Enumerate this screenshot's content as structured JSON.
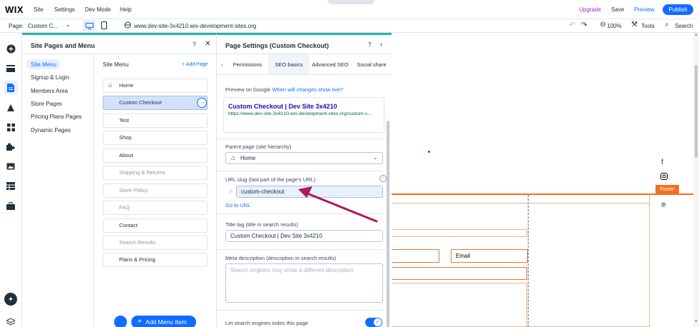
{
  "topbar": {
    "logo": "WIX",
    "menu": [
      "Site",
      "Settings",
      "Dev Mode",
      "Help"
    ],
    "upgrade": "Upgrade",
    "save": "Save",
    "preview": "Preview",
    "publish": "Publish"
  },
  "bar2": {
    "page_label": "Page:",
    "page_value": "Custom C...",
    "url": "www.dev-site-3x4210.wix-development-sites.org",
    "zoom": "100%",
    "tools": "Tools",
    "search": "Search"
  },
  "pages_panel": {
    "title": "Site Pages and Menu",
    "help": "?",
    "categories": [
      "Site Menu",
      "Signup & Login",
      "Members Area",
      "Store Pages",
      "Pricing Plans Pages",
      "Dynamic Pages"
    ],
    "menu_header": "Site Menu",
    "add_page": "+ Add Page",
    "pages": [
      "Home",
      "Custom Checkout",
      "Test",
      "Shop",
      "About",
      "Shipping & Returns",
      "Store Policy",
      "FAQ",
      "Contact",
      "Search Results",
      "Plans & Pricing"
    ],
    "add_menu_item": "Add Menu Item"
  },
  "settings_panel": {
    "title": "Page Settings (Custom Checkout)",
    "help": "?",
    "tabs": [
      "Permissions",
      "SEO basics",
      "Advanced SEO",
      "Social share"
    ],
    "preview_label": "Preview on Google",
    "preview_link": "When will changes show live?",
    "google_title": "Custom Checkout | Dev Site 3x4210",
    "google_url": "https://www.dev-site-3x4210.wix-development-sites.org/custom-c...",
    "parent_label": "Parent page (site hierarchy)",
    "parent_value": "Home",
    "slug_label": "URL slug (last part of the page's URL)",
    "slug_prefix": "/",
    "slug_value": "custom-checkout",
    "go_to_url": "Go to URL",
    "title_tag_label": "Title tag (title in search results)",
    "title_tag_value": "Custom Checkout | Dev Site 3x4210",
    "meta_label": "Meta description (description in search results)",
    "meta_placeholder": "Search engines may show a different description",
    "index_label": "Let search engines index this page",
    "index_on": true
  },
  "canvas": {
    "footer_badge": "Footer",
    "email_field": "Email"
  },
  "colors": {
    "accent_blue": "#116dff",
    "teal": "#21b4a9",
    "footer_orange": "#f26f21",
    "arrow": "#b0185a",
    "upgrade": "#9a27d5"
  }
}
